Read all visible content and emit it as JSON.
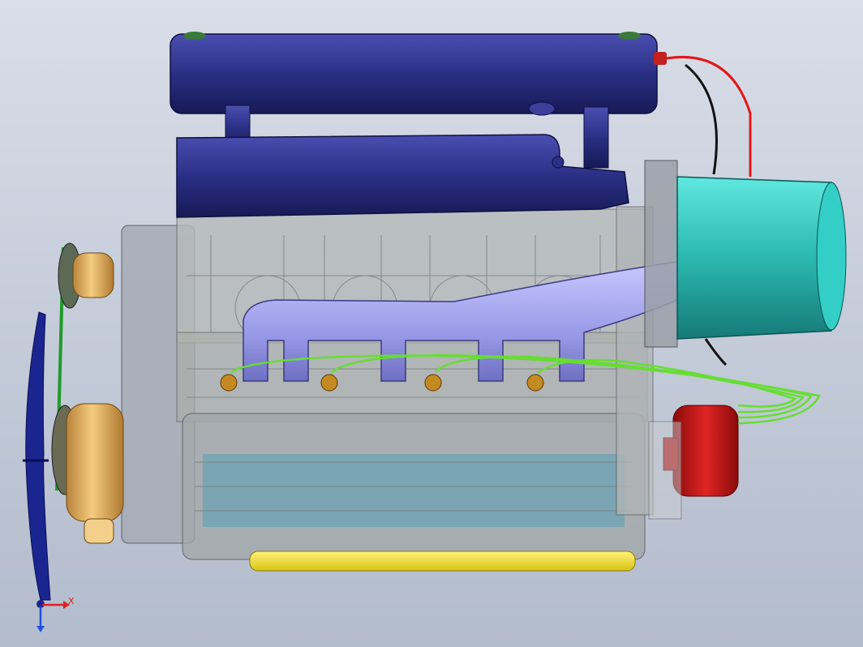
{
  "viewport": {
    "background_top": "#d9dee8",
    "background_bottom": "#b3bccd"
  },
  "model": {
    "parts": [
      "valve-cover",
      "intake-plenum",
      "engine-block",
      "intake-runners",
      "spark-plugs",
      "ignition-leads",
      "oil-pan",
      "fan",
      "water-pump-pulley",
      "crank-pulley",
      "drive-belt",
      "flywheel-housing",
      "starter-motor",
      "distributor"
    ],
    "colors": {
      "valve_cover": "#2b2f85",
      "runners": "#9a9be8",
      "housing": "#2bb8b0",
      "starter": "#cc1a1a",
      "pulley": "#e0b060",
      "oil_pan": "#f0e030",
      "wires": "#66dd33",
      "red_wire": "#e01818",
      "fan": "#1a2590"
    }
  },
  "triad": {
    "x_label": "X",
    "x_color": "#e02020",
    "y_color": "#2050e0"
  }
}
